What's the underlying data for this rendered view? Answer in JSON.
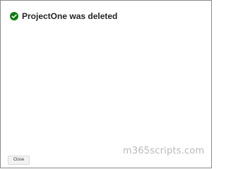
{
  "dialog": {
    "message": "ProjectOne was deleted",
    "status_icon": "check-circle-icon",
    "status_color": "#107c10",
    "close_label": "Close"
  },
  "watermark": {
    "text": "m365scripts.com"
  }
}
